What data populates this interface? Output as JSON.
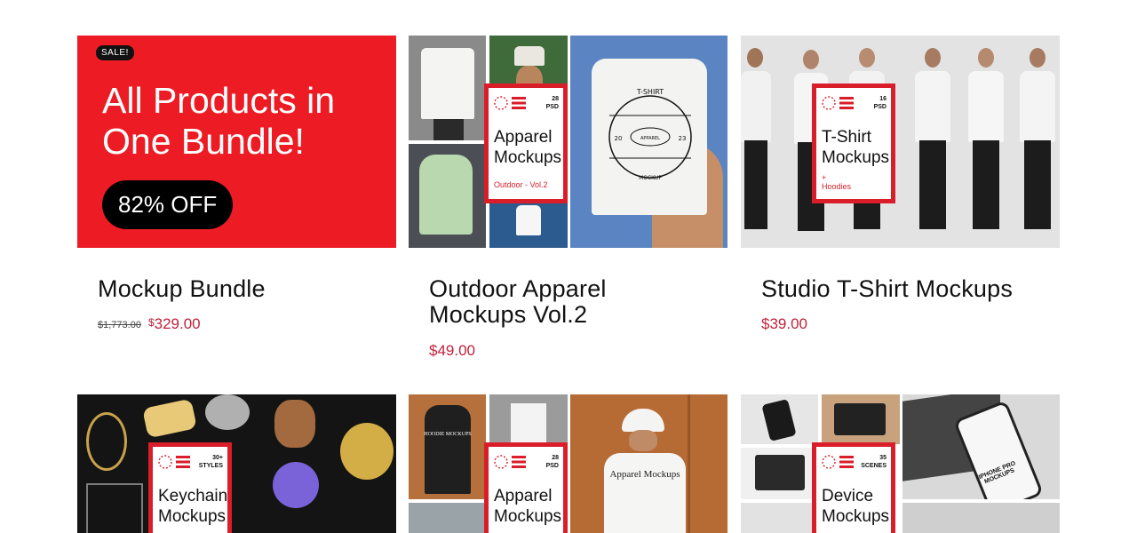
{
  "products": [
    {
      "title": "Mockup Bundle",
      "old_price": "$1,773.00",
      "price_sign": "$",
      "price": "329.00",
      "promo": {
        "badge": "SALE!",
        "headline": "All Products in One Bundle!",
        "discount": "82% OFF"
      }
    },
    {
      "title": "Outdoor Apparel Mockups Vol.2",
      "price": "$49.00",
      "label": {
        "count": "28",
        "unit": "PSD",
        "name": "Apparel Mockups",
        "sub": "Outdoor - Vol.2"
      },
      "shirt_print": {
        "top": "T-SHIRT",
        "left": "20",
        "center": "APPAREL",
        "right": "23",
        "bottom": "MOCKUP"
      }
    },
    {
      "title": "Studio T-Shirt Mockups",
      "price": "$39.00",
      "label": {
        "count": "16",
        "unit": "PSD",
        "name": "T-Shirt Mockups",
        "plus": "+",
        "sub": "Hoodies"
      }
    },
    {
      "label": {
        "count": "30+",
        "unit": "STYLES",
        "name": "Keychain Mockups"
      }
    },
    {
      "label": {
        "count": "28",
        "unit": "PSD",
        "name": "Apparel Mockups"
      },
      "hoodie_text": "HOODIE MOCKUPS",
      "tee_text": "Apparel Mockups"
    },
    {
      "label": {
        "count": "35",
        "unit": "SCENES",
        "name": "Device Mockups"
      },
      "screen_text": "IPHONE PRO MOCKUPS"
    }
  ],
  "colors": {
    "accent": "#ed1c24",
    "price": "#c0213a",
    "label_border": "#d91e2a"
  }
}
